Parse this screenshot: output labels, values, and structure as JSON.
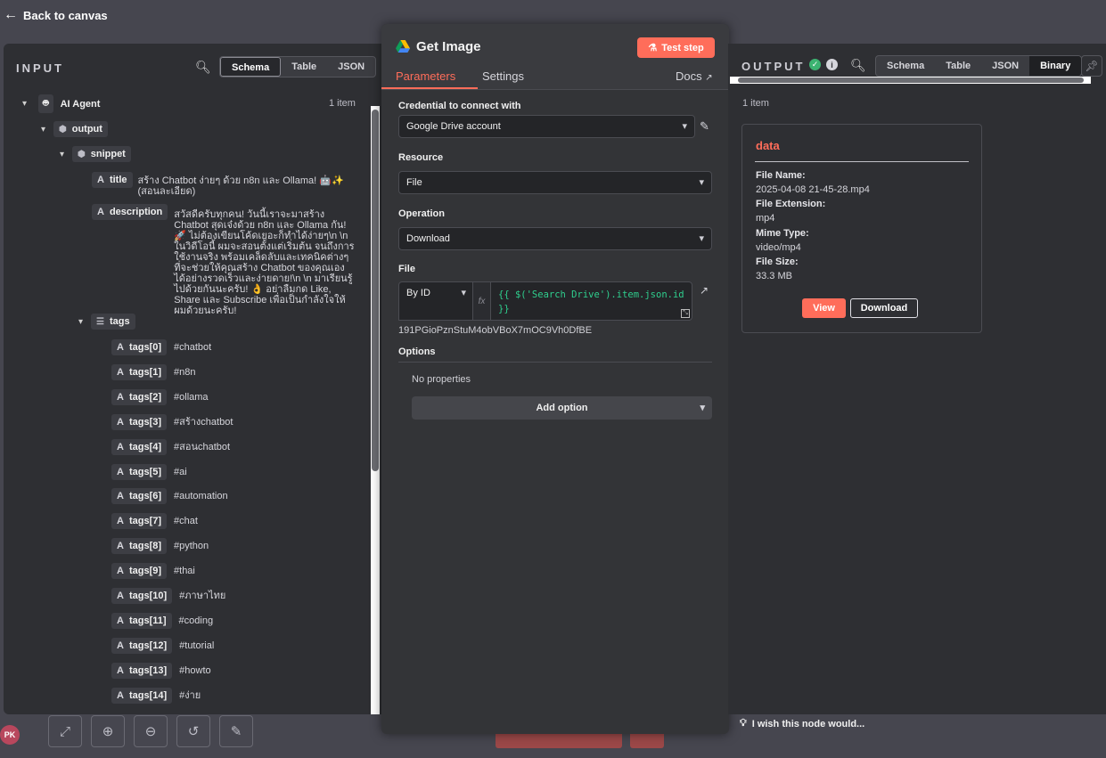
{
  "nav": {
    "back_label": "Back to canvas"
  },
  "canvas": {
    "avatar": "PK"
  },
  "input": {
    "title": "INPUT",
    "tabs": [
      "Schema",
      "Table",
      "JSON"
    ],
    "item_count": "1 item",
    "tree": {
      "root": "AI Agent",
      "output": "output",
      "snippet": "snippet",
      "title_key": "title",
      "title_value": "สร้าง Chatbot ง่ายๆ ด้วย n8n และ Ollama! 🤖✨ (สอนละเอียด)",
      "desc_key": "description",
      "desc_value": "สวัสดีครับทุกคน! วันนี้เราจะมาสร้าง Chatbot สุดเจ๋งด้วย n8n และ Ollama กัน! 🚀 ไม่ต้องเขียนโค้ดเยอะก็ทำได้ง่ายๆ\\n \\n ในวิดีโอนี้ ผมจะสอนตั้งแต่เริ่มต้น จนถึงการใช้งานจริง พร้อมเคล็ดลับและเทคนิคต่างๆ ที่จะช่วยให้คุณสร้าง Chatbot ของคุณเองได้อย่างรวดเร็วและง่ายดาย!\\n \\n มาเรียนรู้ไปด้วยกันนะครับ! 👌 อย่าลืมกด Like, Share และ Subscribe เพื่อเป็นกำลังใจให้ผมด้วยนะครับ!",
      "tags_key": "tags",
      "tags": [
        {
          "key": "tags[0]",
          "value": "#chatbot"
        },
        {
          "key": "tags[1]",
          "value": "#n8n"
        },
        {
          "key": "tags[2]",
          "value": "#ollama"
        },
        {
          "key": "tags[3]",
          "value": "#สร้างchatbot"
        },
        {
          "key": "tags[4]",
          "value": "#สอนchatbot"
        },
        {
          "key": "tags[5]",
          "value": "#ai"
        },
        {
          "key": "tags[6]",
          "value": "#automation"
        },
        {
          "key": "tags[7]",
          "value": "#chat"
        },
        {
          "key": "tags[8]",
          "value": "#python"
        },
        {
          "key": "tags[9]",
          "value": "#thai"
        },
        {
          "key": "tags[10]",
          "value": "#ภาษาไทย"
        },
        {
          "key": "tags[11]",
          "value": "#coding"
        },
        {
          "key": "tags[12]",
          "value": "#tutorial"
        },
        {
          "key": "tags[13]",
          "value": "#howto"
        },
        {
          "key": "tags[14]",
          "value": "#ง่าย"
        }
      ]
    }
  },
  "node": {
    "title": "Get Image",
    "test_label": "Test step",
    "tabs": {
      "parameters": "Parameters",
      "settings": "Settings"
    },
    "docs_label": "Docs",
    "credential_label": "Credential to connect with",
    "credential_value": "Google Drive account",
    "resource_label": "Resource",
    "resource_value": "File",
    "operation_label": "Operation",
    "operation_value": "Download",
    "file_label": "File",
    "file_mode": "By ID",
    "fx_label": "fx",
    "file_expression": "{{ $('Search Drive').item.json.id }}",
    "file_id": "191PGioPznStuM4obVBoX7mOC9Vh0DfBE",
    "options_label": "Options",
    "no_properties": "No properties",
    "add_option": "Add option"
  },
  "output": {
    "title": "OUTPUT",
    "tabs": [
      "Schema",
      "Table",
      "JSON",
      "Binary"
    ],
    "item_count": "1 item",
    "binary": {
      "title": "data",
      "fields": [
        {
          "k": "File Name:",
          "v": "2025-04-08 21-45-28.mp4"
        },
        {
          "k": "File Extension:",
          "v": "mp4"
        },
        {
          "k": "Mime Type:",
          "v": "video/mp4"
        },
        {
          "k": "File Size:",
          "v": "33.3 MB"
        }
      ],
      "view_label": "View",
      "download_label": "Download"
    }
  },
  "feedback": {
    "label": "I wish this node would..."
  },
  "colors": {
    "accent": "#ff6d5a",
    "success": "#3cb371",
    "expression": "#2fcf8e"
  }
}
